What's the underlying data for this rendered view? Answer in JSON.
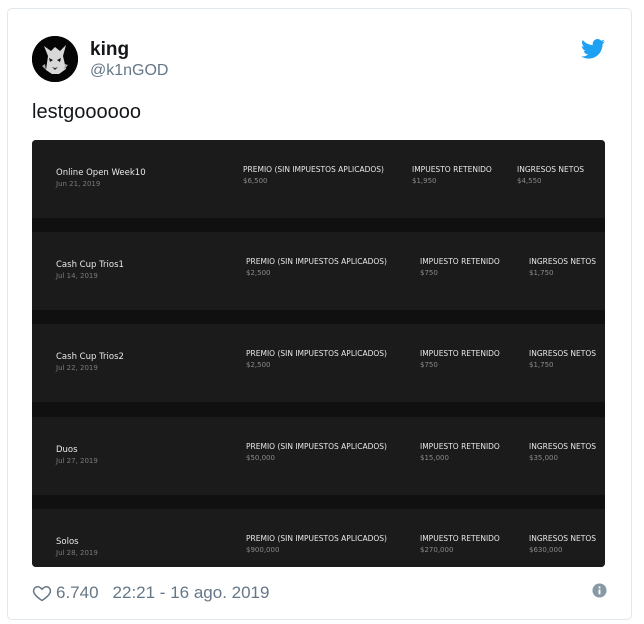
{
  "tweet": {
    "display_name": "king",
    "handle": "@k1nGOD",
    "text": "lestgoooooo",
    "likes": "6.740",
    "timestamp": "22:21 - 16 ago. 2019"
  },
  "icons": {
    "avatar": "wolf-avatar",
    "brand": "twitter-bird-icon",
    "like": "heart-icon",
    "info": "info-icon"
  },
  "colors": {
    "twitter_blue": "#1da1f2",
    "secondary_text": "#657786",
    "media_bg": "#101010",
    "row_bg": "#1b1b1b"
  },
  "earnings": [
    {
      "event": "Online Open Week10",
      "date": "Jun 21, 2019",
      "prize_label": "PREMIO (SIN IMPUESTOS APLICADOS)",
      "prize": "$6,500",
      "tax_label": "IMPUESTO RETENIDO",
      "tax": "$1,950",
      "net_label": "INGRESOS NETOS",
      "net": "$4,550"
    },
    {
      "event": "Cash Cup Trios1",
      "date": "Jul 14, 2019",
      "prize_label": "PREMIO (SIN IMPUESTOS APLICADOS)",
      "prize": "$2,500",
      "tax_label": "IMPUESTO RETENIDO",
      "tax": "$750",
      "net_label": "INGRESOS NETOS",
      "net": "$1,750"
    },
    {
      "event": "Cash Cup Trios2",
      "date": "Jul 22, 2019",
      "prize_label": "PREMIO (SIN IMPUESTOS APLICADOS)",
      "prize": "$2,500",
      "tax_label": "IMPUESTO RETENIDO",
      "tax": "$750",
      "net_label": "INGRESOS NETOS",
      "net": "$1,750"
    },
    {
      "event": "Duos",
      "date": "Jul 27, 2019",
      "prize_label": "PREMIO (SIN IMPUESTOS APLICADOS)",
      "prize": "$50,000",
      "tax_label": "IMPUESTO RETENIDO",
      "tax": "$15,000",
      "net_label": "INGRESOS NETOS",
      "net": "$35,000"
    },
    {
      "event": "Solos",
      "date": "Jul 28, 2019",
      "prize_label": "PREMIO (SIN IMPUESTOS APLICADOS)",
      "prize": "$900,000",
      "tax_label": "IMPUESTO RETENIDO",
      "tax": "$270,000",
      "net_label": "INGRESOS NETOS",
      "net": "$630,000"
    }
  ]
}
